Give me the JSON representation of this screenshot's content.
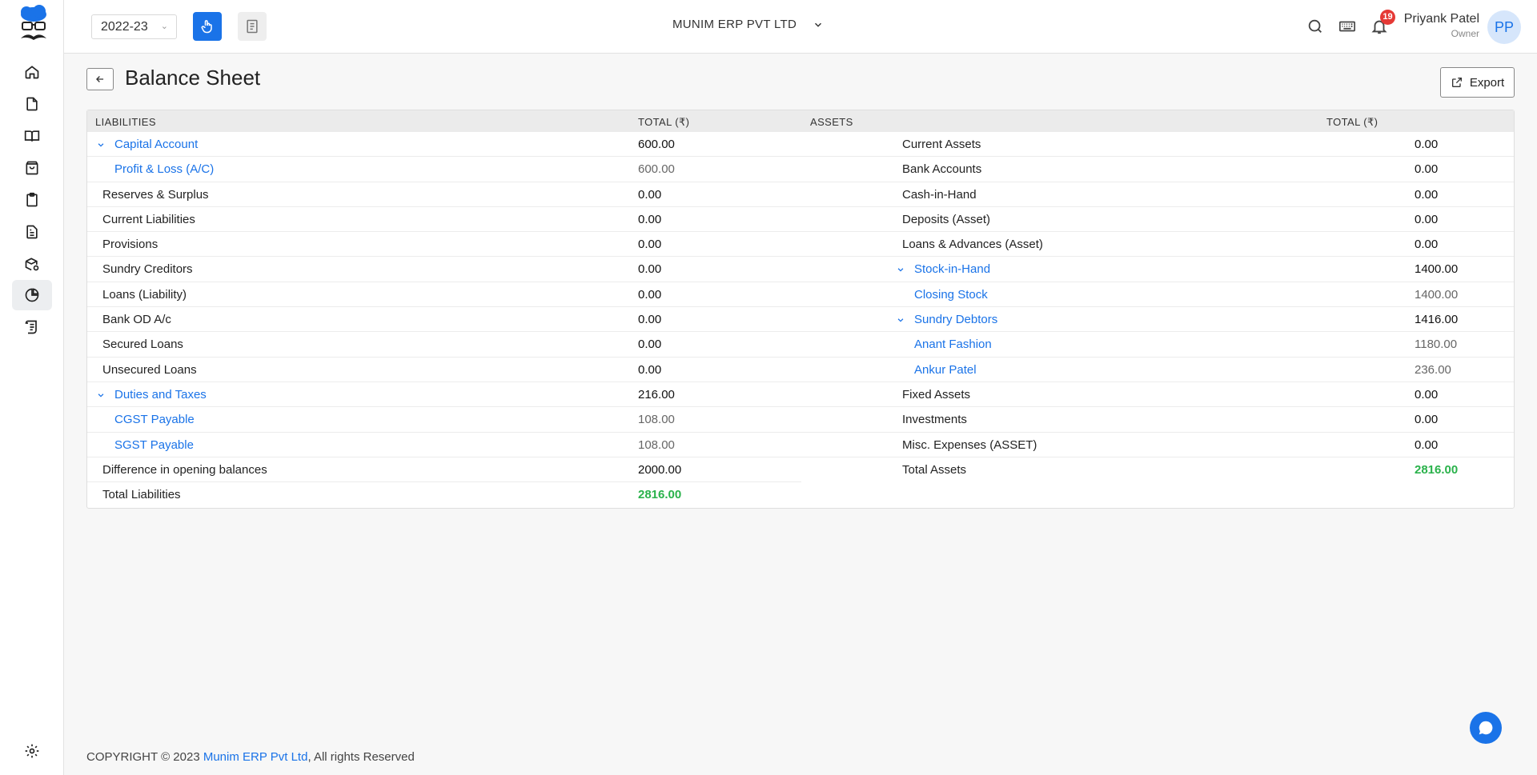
{
  "header": {
    "year": "2022-23",
    "company": "MUNIM ERP PVT LTD",
    "notifications_count": "19",
    "user_name": "Priyank Patel",
    "user_role": "Owner",
    "user_initials": "PP"
  },
  "page": {
    "title": "Balance Sheet",
    "export_label": "Export"
  },
  "table": {
    "liabilities_header": "LIABILITIES",
    "assets_header": "ASSETS",
    "total_header": "TOTAL (₹)",
    "liabilities": [
      {
        "name": "Capital Account",
        "value": "600.00",
        "kind": "group"
      },
      {
        "name": "Profit & Loss (A/C)",
        "value": "600.00",
        "kind": "child"
      },
      {
        "name": "Reserves & Surplus",
        "value": "0.00",
        "kind": "plain"
      },
      {
        "name": "Current Liabilities",
        "value": "0.00",
        "kind": "plain"
      },
      {
        "name": "Provisions",
        "value": "0.00",
        "kind": "plain"
      },
      {
        "name": "Sundry Creditors",
        "value": "0.00",
        "kind": "plain"
      },
      {
        "name": "Loans (Liability)",
        "value": "0.00",
        "kind": "plain"
      },
      {
        "name": "Bank OD A/c",
        "value": "0.00",
        "kind": "plain"
      },
      {
        "name": "Secured Loans",
        "value": "0.00",
        "kind": "plain"
      },
      {
        "name": "Unsecured Loans",
        "value": "0.00",
        "kind": "plain"
      },
      {
        "name": "Duties and Taxes",
        "value": "216.00",
        "kind": "group"
      },
      {
        "name": "CGST Payable",
        "value": "108.00",
        "kind": "child"
      },
      {
        "name": "SGST Payable",
        "value": "108.00",
        "kind": "child"
      },
      {
        "name": "Difference in opening balances",
        "value": "2000.00",
        "kind": "plain"
      },
      {
        "name": "Total Liabilities",
        "value": "2816.00",
        "kind": "total"
      }
    ],
    "assets": [
      {
        "name": "Current Assets",
        "value": "0.00",
        "kind": "plain"
      },
      {
        "name": "Bank Accounts",
        "value": "0.00",
        "kind": "plain"
      },
      {
        "name": "Cash-in-Hand",
        "value": "0.00",
        "kind": "plain"
      },
      {
        "name": "Deposits (Asset)",
        "value": "0.00",
        "kind": "plain"
      },
      {
        "name": "Loans & Advances (Asset)",
        "value": "0.00",
        "kind": "plain"
      },
      {
        "name": "Stock-in-Hand",
        "value": "1400.00",
        "kind": "group"
      },
      {
        "name": "Closing Stock",
        "value": "1400.00",
        "kind": "child"
      },
      {
        "name": "Sundry Debtors",
        "value": "1416.00",
        "kind": "group"
      },
      {
        "name": "Anant Fashion",
        "value": "1180.00",
        "kind": "child"
      },
      {
        "name": "Ankur Patel",
        "value": "236.00",
        "kind": "child"
      },
      {
        "name": "Fixed Assets",
        "value": "0.00",
        "kind": "plain"
      },
      {
        "name": "Investments",
        "value": "0.00",
        "kind": "plain"
      },
      {
        "name": "Misc. Expenses (ASSET)",
        "value": "0.00",
        "kind": "plain"
      },
      {
        "name": "Total Assets",
        "value": "2816.00",
        "kind": "total"
      }
    ]
  },
  "footer": {
    "prefix": "COPYRIGHT © 2023 ",
    "link": "Munim ERP Pvt Ltd",
    "suffix": ", All rights Reserved"
  },
  "colors": {
    "accent": "#1a73e8",
    "total_green": "#2ab24b",
    "badge_red": "#e53935"
  },
  "icons": {
    "sidebar": [
      "home-icon",
      "file-icon",
      "book-icon",
      "shopping-bag-icon",
      "clipboard-icon",
      "document-icon",
      "package-settings-icon",
      "pie-chart-icon",
      "ledger-icon",
      "settings-icon"
    ],
    "header": [
      "hand-pointer-icon",
      "notes-icon",
      "chevron-down-icon",
      "search-icon",
      "keyboard-icon",
      "bell-icon"
    ]
  }
}
